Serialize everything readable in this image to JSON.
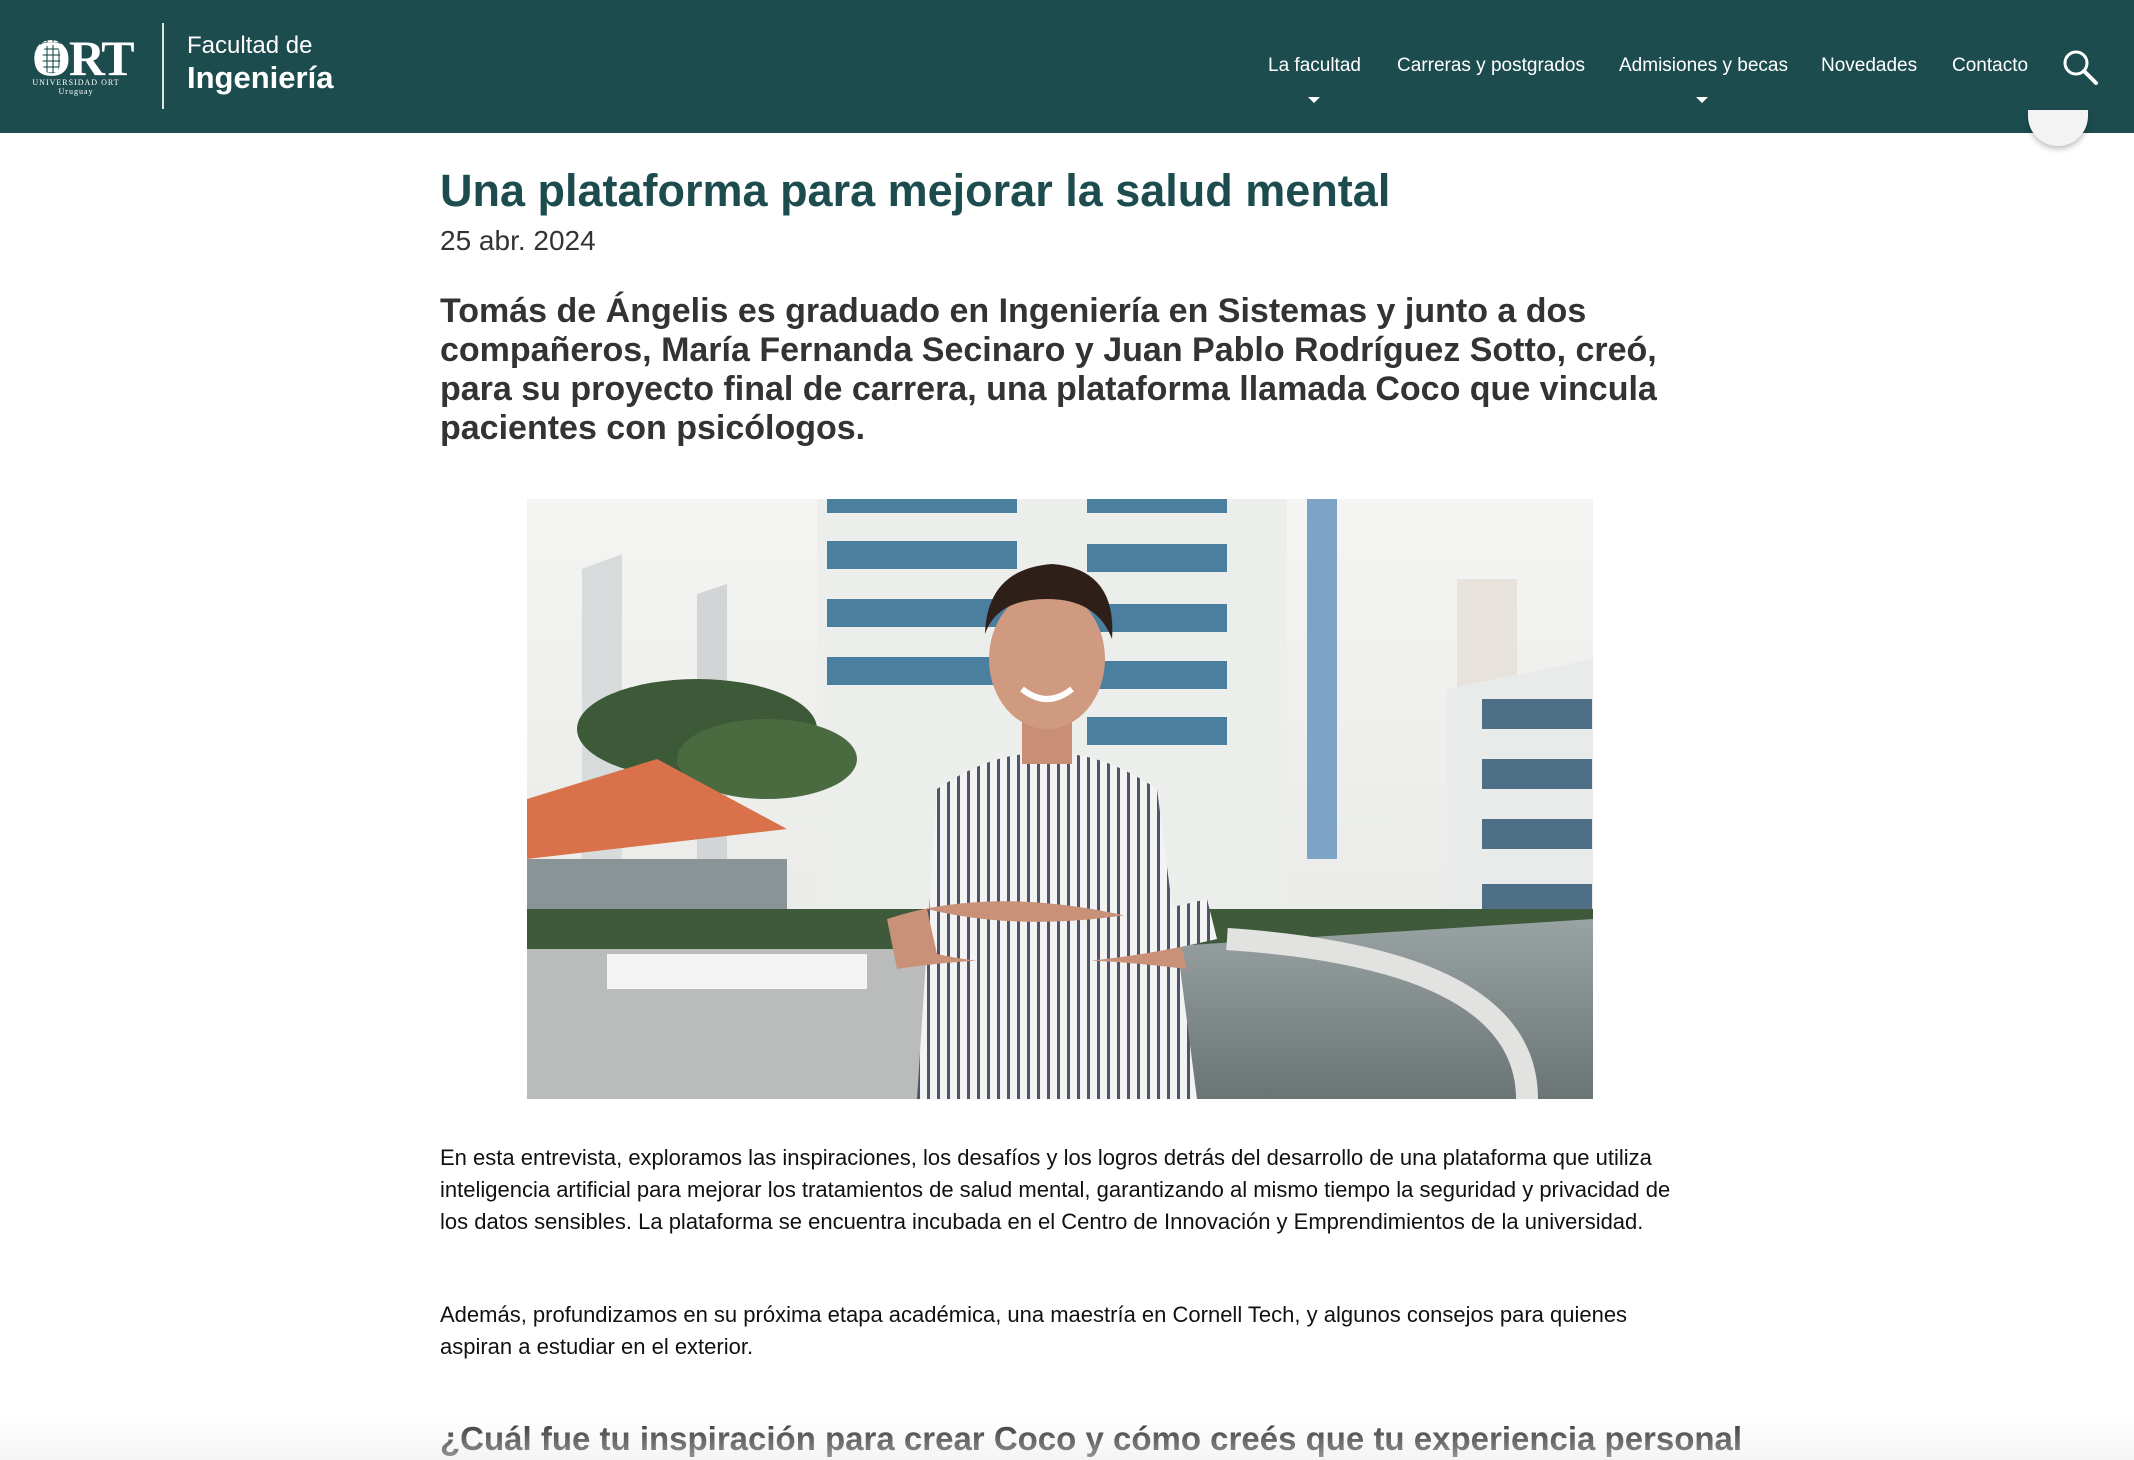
{
  "header": {
    "logo": {
      "brand": "ORT",
      "subtitle": "UNIVERSIDAD ORT",
      "country": "Uruguay"
    },
    "faculty_line1": "Facultad de",
    "faculty_line2": "Ingeniería",
    "nav": [
      {
        "label": "La facultad",
        "has_dropdown": true
      },
      {
        "label": "Carreras y postgrados",
        "has_dropdown": false
      },
      {
        "label": "Admisiones y becas",
        "has_dropdown": true
      },
      {
        "label": "Novedades",
        "has_dropdown": false
      },
      {
        "label": "Contacto",
        "has_dropdown": false
      }
    ],
    "search_icon": "search-icon"
  },
  "article": {
    "title": "Una plataforma para mejorar la salud mental",
    "date": "25 abr. 2024",
    "lead": "Tomás de Ángelis es graduado en Ingeniería en Sistemas y junto a dos compañeros, María Fernanda Secinaro y Juan Pablo Rodríguez Sotto, creó, para su proyecto final de carrera, una plataforma llamada Coco que vincula pacientes con psicólogos.",
    "paragraphs": [
      "En esta entrevista, exploramos las inspiraciones, los desafíos y los logros detrás del desarrollo de una plataforma que utiliza inteligencia artificial para mejorar los tratamientos de salud mental, garantizando al mismo tiempo la seguridad y privacidad de los datos sensibles. La plataforma se encuentra incubada en el Centro de Innovación y Emprendimientos de la universidad.",
      "Además, profundizamos en su próxima etapa académica, una maestría en Cornell Tech, y algunos consejos para quienes aspiran a estudiar en el exterior."
    ],
    "subheading": "¿Cuál fue tu inspiración para crear Coco y cómo creés que tu experiencia personal"
  },
  "colors": {
    "header_bg": "#1d4c4e",
    "title": "#1d4c4e",
    "text": "#111111"
  }
}
